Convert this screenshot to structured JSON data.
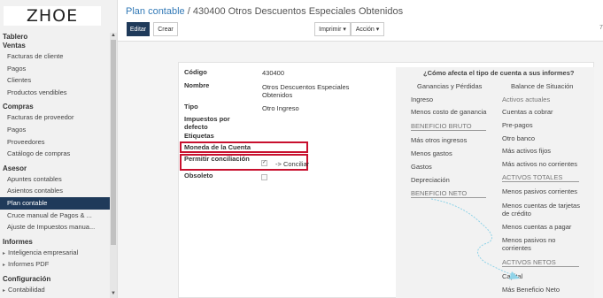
{
  "sidebar": {
    "logo": "ZHOE",
    "sections": [
      {
        "title": "Tablero"
      },
      {
        "title": "Ventas",
        "items": [
          "Facturas de cliente",
          "Pagos",
          "Clientes",
          "Productos vendibles"
        ]
      },
      {
        "title": "Compras",
        "items": [
          "Facturas de proveedor",
          "Pagos",
          "Proveedores",
          "Catálogo de compras"
        ]
      },
      {
        "title": "Asesor",
        "items": [
          "Apuntes contables",
          "Asientos contables",
          "Plan contable",
          "Cruce manual de Pagos & ...",
          "Ajuste de Impuestos manua..."
        ]
      },
      {
        "title": "Informes",
        "items": [
          "Inteligencia empresarial",
          "Informes PDF"
        ]
      },
      {
        "title": "Configuración",
        "items": [
          "Contabilidad"
        ]
      }
    ],
    "active_item": "Plan contable"
  },
  "header": {
    "breadcrumb_root": "Plan contable",
    "breadcrumb_sep": "/",
    "breadcrumb_current": "430400 Otros Descuentos Especiales Obtenidos",
    "edit_label": "Editar",
    "create_label": "Crear",
    "print_label": "Imprimir ▾",
    "action_label": "Acción ▾",
    "edge_number": "7"
  },
  "form": {
    "codigo_label": "Código",
    "codigo_value": "430400",
    "nombre_label": "Nombre",
    "nombre_value_1": "Otros Descuentos Especiales",
    "nombre_value_2": "Obtenidos",
    "tipo_label": "Tipo",
    "tipo_value": "Otro Ingreso",
    "impuestos_label_1": "Impuestos por",
    "impuestos_label_2": "defecto",
    "etiquetas_label": "Etiquetas",
    "moneda_label": "Moneda de la Cuenta",
    "conciliacion_label": "Permitir conciliación",
    "conciliacion_checked": true,
    "conciliar_label": "-> Conciliar",
    "obsoleto_label": "Obsoleto",
    "obsoleto_checked": false
  },
  "info_panel": {
    "title": "¿Cómo afecta el tipo de cuenta a sus informes?",
    "left_heading": "Ganancias y Pérdidas",
    "right_heading": "Balance de Situación",
    "left_items": [
      "Ingreso",
      "Menos costo de ganancia",
      "BENEFICIO BRUTO",
      "Más otros ingresos",
      "Menos gastos",
      "Gastos",
      "Depreciación",
      "BENEFICIO NETO"
    ],
    "right_items": [
      "Activos actuales",
      "Cuentas a cobrar",
      "Pre-pagos",
      "Otro banco",
      "Más activos fijos",
      "Más activos no corrientes",
      "ACTIVOS TOTALES",
      "Menos pasivos corrientes",
      "Menos cuentas de tarjetas",
      "de crédito",
      "Menos cuentas a pagar",
      "Menos pasivos no",
      "corrientes",
      "ACTIVOS NETOS",
      "Capital",
      "Más Beneficio Neto"
    ]
  }
}
